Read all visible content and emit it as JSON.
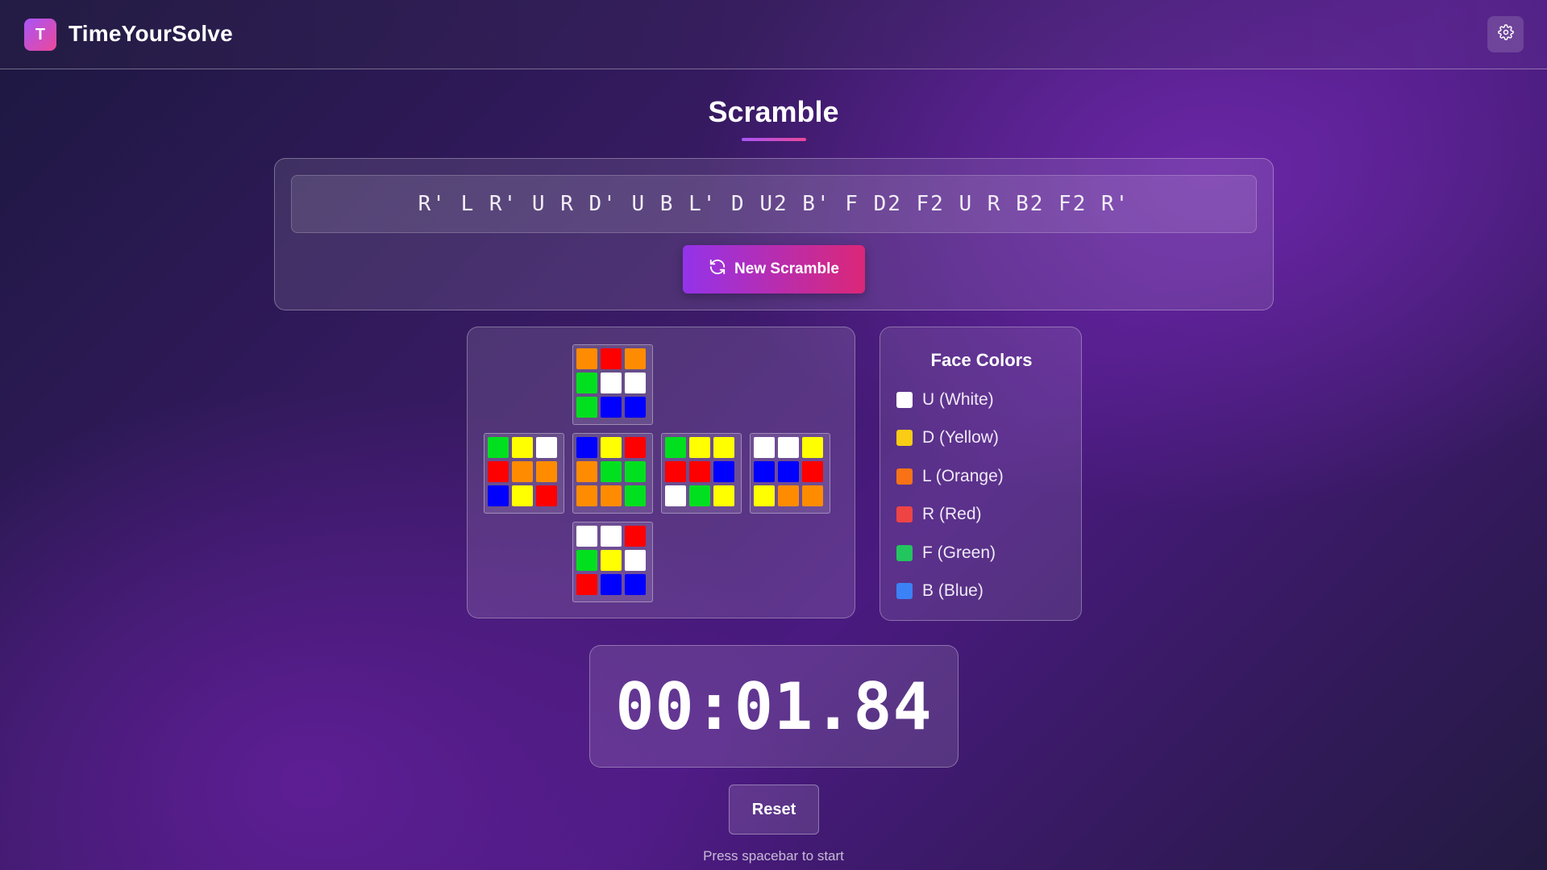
{
  "header": {
    "logo_letter": "T",
    "app_title": "TimeYourSolve",
    "settings_icon": "gear-icon"
  },
  "scramble": {
    "heading": "Scramble",
    "sequence": "R' L R' U R D' U B L' D U2 B' F D2 F2 U R B2 F2 R'",
    "new_button_label": "New Scramble",
    "new_button_icon": "refresh-icon"
  },
  "cube_net": {
    "colors": {
      "W": "#ffffff",
      "Y": "#ffff00",
      "O": "#ff8c00",
      "R": "#ff0000",
      "G": "#00e01e",
      "B": "#0000ff"
    },
    "faces": {
      "U": [
        "O",
        "R",
        "O",
        "G",
        "W",
        "W",
        "G",
        "B",
        "B"
      ],
      "L": [
        "G",
        "Y",
        "W",
        "R",
        "O",
        "O",
        "B",
        "Y",
        "R"
      ],
      "F": [
        "B",
        "Y",
        "R",
        "O",
        "G",
        "G",
        "O",
        "O",
        "G"
      ],
      "R": [
        "G",
        "Y",
        "Y",
        "R",
        "R",
        "B",
        "W",
        "G",
        "Y"
      ],
      "B": [
        "W",
        "W",
        "Y",
        "B",
        "B",
        "R",
        "Y",
        "O",
        "O"
      ],
      "D": [
        "W",
        "W",
        "R",
        "G",
        "Y",
        "W",
        "R",
        "B",
        "B"
      ]
    }
  },
  "legend": {
    "title": "Face Colors",
    "items": [
      {
        "label": "U (White)",
        "color": "#ffffff"
      },
      {
        "label": "D (Yellow)",
        "color": "#facc15"
      },
      {
        "label": "L (Orange)",
        "color": "#f97316"
      },
      {
        "label": "R (Red)",
        "color": "#ef4444"
      },
      {
        "label": "F (Green)",
        "color": "#22c55e"
      },
      {
        "label": "B (Blue)",
        "color": "#3b82f6"
      }
    ]
  },
  "timer": {
    "display": "00:01.84",
    "reset_label": "Reset",
    "hint": "Press spacebar to start"
  }
}
